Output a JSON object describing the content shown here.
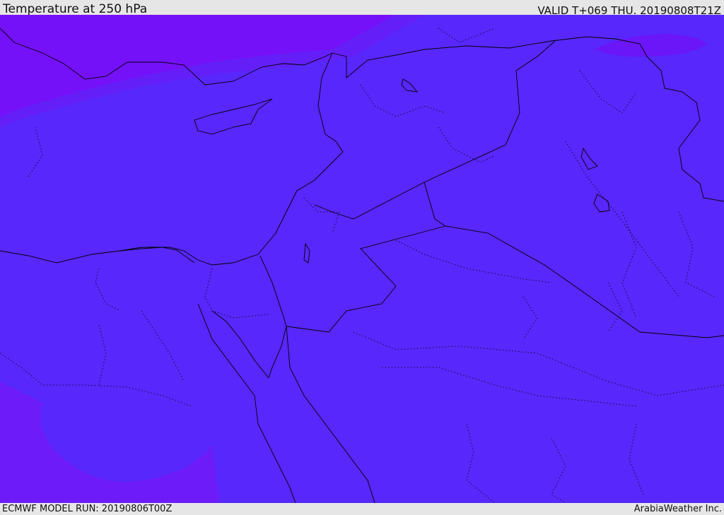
{
  "header": {
    "title": "Temperature at 250 hPa",
    "valid": "VALID T+069 THU. 20190808T21Z"
  },
  "footer": {
    "model_run": "ECMWF MODEL RUN: 20190806T00Z",
    "credit": "ArabiaWeather Inc."
  },
  "map": {
    "field": "temperature-250hPa",
    "colors": {
      "base": "#5827fb",
      "cold_north": "#7a0ef7",
      "cold_southwest": "#6d1cf9",
      "border": "#000000"
    }
  }
}
